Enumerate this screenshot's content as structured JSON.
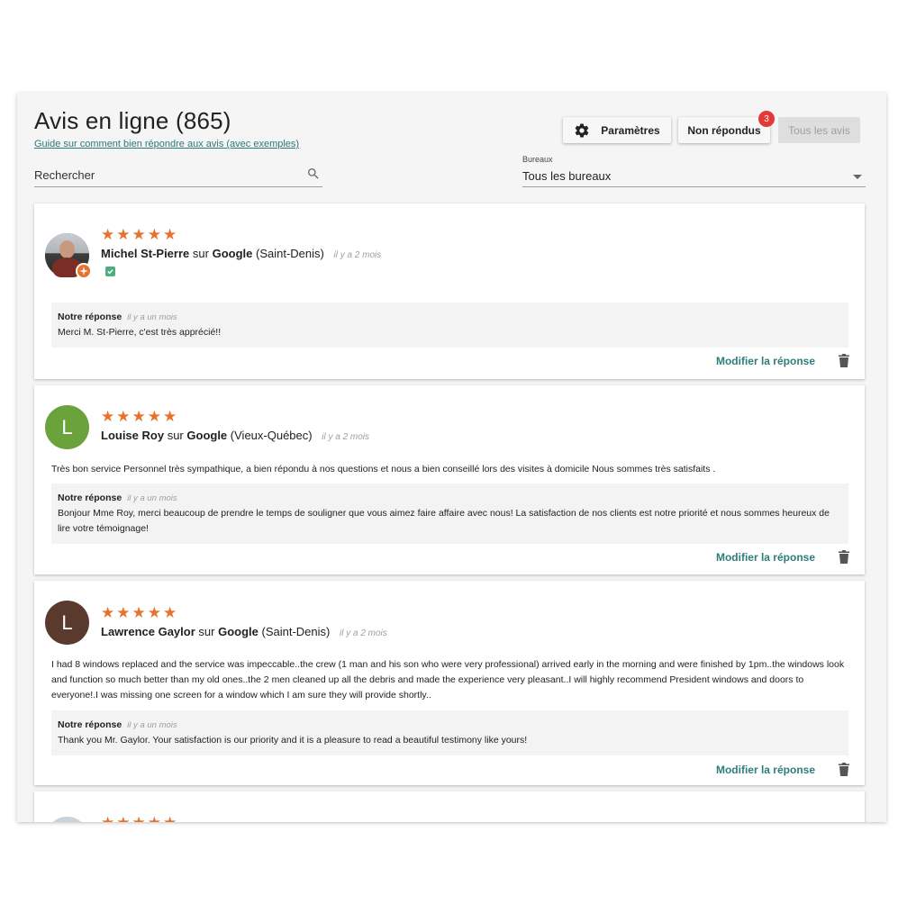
{
  "header": {
    "title": "Avis en ligne (865)",
    "guide_link": "Guide sur comment bien répondre aux avis (avec exemples)"
  },
  "toolbar": {
    "params_label": "Paramètres",
    "unanswered_label": "Non répondus",
    "unanswered_count": "3",
    "all_label": "Tous les avis"
  },
  "filters": {
    "search_placeholder": "Rechercher",
    "office_label": "Bureaux",
    "office_value": "Tous les bureaux"
  },
  "reviews": [
    {
      "rating": 5,
      "name": "Michel St-Pierre",
      "on": "sur",
      "platform": "Google",
      "location": "(Saint-Denis)",
      "time": "il y a 2 mois",
      "text": "",
      "reply_label": "Notre réponse",
      "reply_time": "il y a un mois",
      "reply_text": "Merci M. St-Pierre, c'est très apprécié!!",
      "edit_label": "Modifier la réponse"
    },
    {
      "initial": "L",
      "avatar_color": "#6aa23b",
      "rating": 5,
      "name": "Louise Roy",
      "on": "sur",
      "platform": "Google",
      "location": "(Vieux-Québec)",
      "time": "il y a 2 mois",
      "text": "Très bon service Personnel très sympathique, a bien répondu à nos questions et nous a bien conseillé lors des visites à domicile Nous sommes très satisfaits .",
      "reply_label": "Notre réponse",
      "reply_time": "il y a un mois",
      "reply_text": "Bonjour Mme Roy, merci beaucoup de prendre le temps de souligner que vous aimez faire affaire avec nous! La satisfaction de nos clients est notre priorité et nous sommes heureux de lire votre témoignage!",
      "edit_label": "Modifier la réponse"
    },
    {
      "initial": "L",
      "avatar_color": "#5b3a2e",
      "rating": 5,
      "name": "Lawrence Gaylor",
      "on": "sur",
      "platform": "Google",
      "location": "(Saint-Denis)",
      "time": "il y a 2 mois",
      "text": "I had 8 windows replaced and the service was impeccable..the crew (1 man and his son who were very professional) arrived early in the morning and were finished by 1pm..the windows look and function so much better than my old ones..the 2 men cleaned up all the debris and made the experience very pleasant..I will highly recommend President windows and doors to everyone!.I was missing one screen for a window which I am sure they will provide shortly..",
      "reply_label": "Notre réponse",
      "reply_time": "il y a un mois",
      "reply_text": "Thank you Mr. Gaylor. Your satisfaction is our priority and it is a pleasure to read a beautiful testimony like yours!",
      "edit_label": "Modifier la réponse"
    },
    {
      "rating": 5
    }
  ],
  "colors": {
    "accent_star": "#e8712c",
    "link": "#2e7d7b",
    "badge": "#e53935"
  }
}
